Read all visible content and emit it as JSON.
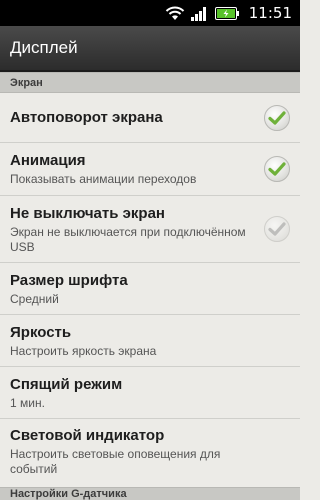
{
  "status_bar": {
    "time": "11:51",
    "icons": [
      "wifi-icon",
      "signal-icon",
      "battery-charging-icon"
    ]
  },
  "title_bar": {
    "title": "Дисплей"
  },
  "section_screen": {
    "label": "Экран"
  },
  "items": [
    {
      "title": "Автоповорот экрана",
      "subtitle": "",
      "checked": true,
      "enabled": true
    },
    {
      "title": "Анимация",
      "subtitle": "Показывать анимации переходов",
      "checked": true,
      "enabled": true
    },
    {
      "title": "Не выключать экран",
      "subtitle": "Экран не выключается при подключённом USB",
      "checked": true,
      "enabled": false
    },
    {
      "title": "Размер шрифта",
      "subtitle": "Средний"
    },
    {
      "title": "Яркость",
      "subtitle": "Настроить яркость экрана"
    },
    {
      "title": "Спящий режим",
      "subtitle": "1 мин."
    },
    {
      "title": "Световой индикатор",
      "subtitle": "Настроить световые оповещения для событий"
    }
  ],
  "section_gsensor": {
    "label": "Настройки G-датчика"
  },
  "colors": {
    "check_enabled": "#6fb13a",
    "check_disabled": "#9a9a9a",
    "battery": "#58c22a"
  }
}
